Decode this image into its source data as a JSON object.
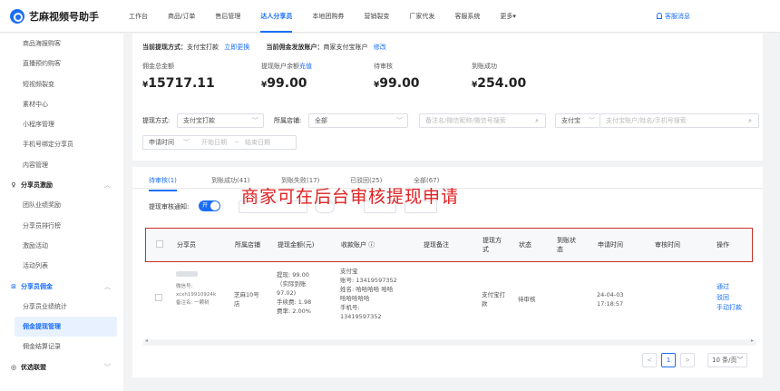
{
  "app": {
    "title": "艺麻视频号助手"
  },
  "nav": [
    "工作台",
    "商品/订单",
    "售后管理",
    "达人分享员",
    "本地团购券",
    "营销裂变",
    "厂家代发",
    "客服系统",
    "更多"
  ],
  "nav_more_arrow": "▾",
  "service": "客服消息",
  "sidebar": {
    "top_items": [
      "商品海报购客",
      "直播预约购客",
      "短视频裂变",
      "素材中心",
      "小程序管理",
      "手机号绑定分享员",
      "内容管理"
    ],
    "group1": {
      "label": "分享员激励",
      "items": [
        "团队业绩奖励",
        "分享员排行榜",
        "激励活动",
        "活动列表"
      ]
    },
    "group2": {
      "label": "分享员佣金",
      "items": [
        "分享员业绩统计",
        "佣金提现管理",
        "佣金结算记录"
      ]
    },
    "group3": {
      "label": "优选联盟"
    },
    "arrow_up": "︿",
    "arrow_down": "﹀"
  },
  "notice": {
    "withdraw_label": "当前提现方式：",
    "withdraw_value": "支付宝打款",
    "change_link": "立即更换",
    "account_label": "当前佣金发放账户：",
    "account_value": "商家支付宝账户",
    "edit_link": "修改"
  },
  "stats": [
    {
      "label": "佣金总金额",
      "value": "15717.11",
      "link": ""
    },
    {
      "label": "提现账户余额",
      "value": "99.00",
      "link": "充值"
    },
    {
      "label": "待审核",
      "value": "99.00",
      "link": ""
    },
    {
      "label": "到账成功",
      "value": "254.00",
      "link": ""
    }
  ],
  "currency": "¥",
  "filters": {
    "method_label": "提现方式:",
    "method_value": "支付宝打款",
    "store_label": "所属店铺:",
    "store_value": "全部",
    "search1_placeholder": "备注名/微信昵称/微信号搜索",
    "account_type": "支付宝",
    "search2_placeholder": "支付宝账户/姓名/手机号搜索",
    "time_type": "申请时间",
    "start_date": "开始日期",
    "date_sep": "~",
    "end_date": "结束日期"
  },
  "tabs": [
    "待审核(1)",
    "到账成功(41)",
    "到账失败(17)",
    "已驳回(25)",
    "全部(67)"
  ],
  "toggle": {
    "label": "提现审核通知:",
    "state": "开"
  },
  "overlay_text": "商家可在后台审核提现申请",
  "table": {
    "headers": [
      "分享员",
      "所属店铺",
      "提现金额(元)",
      "收款账户 ⓘ",
      "提现备注",
      "提现方式",
      "状态",
      "到账状态",
      "申请时间",
      "审核时间",
      "操作"
    ],
    "row": {
      "sharer": [
        "微信号:",
        "xcxh19910924k",
        "备注名: 一颗树"
      ],
      "store": "芝麻10号店",
      "amount": [
        "提现: 99.00",
        "（实际到账",
        "97.02)",
        "手续费: 1.98",
        "费率: 2.00%"
      ],
      "account": [
        "支付宝",
        "账号: 13419597352",
        "姓名: 哈哈哈哈 哈哈",
        "哈哈哈哈哈",
        "手机号:",
        "13419597352"
      ],
      "method": "支付宝打款",
      "status": "待审核",
      "apply_time": [
        "24-04-03",
        "17:18:57"
      ],
      "ops": [
        "通过",
        "驳回",
        "手动打款"
      ]
    }
  },
  "pager": {
    "prev": "<",
    "page": "1",
    "next": ">",
    "size": "10 条/页",
    "size_arrow": "﹀"
  }
}
